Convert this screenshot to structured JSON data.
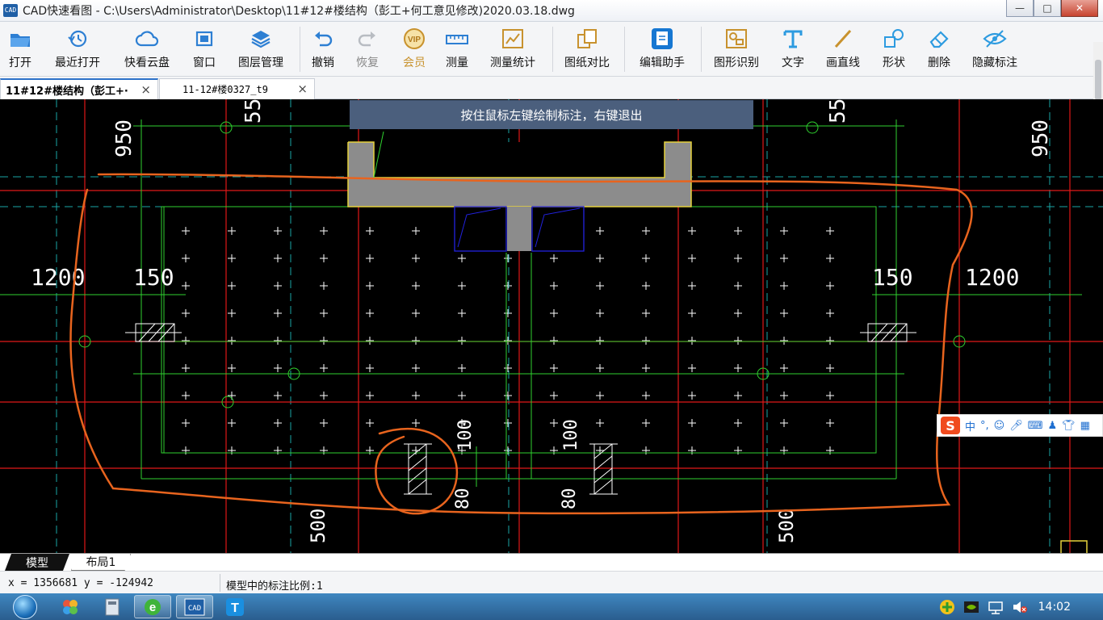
{
  "window": {
    "logo": "CAD",
    "title": "CAD快速看图 - C:\\Users\\Administrator\\Desktop\\11#12#楼结构（彭工+何工意见修改)2020.03.18.dwg",
    "controls": {
      "minimize": "—",
      "maximize": "□",
      "close": "✕"
    }
  },
  "toolbar": {
    "open": "打开",
    "recent": "最近打开",
    "cloud": "快看云盘",
    "window": "窗口",
    "layers": "图层管理",
    "undo": "撤销",
    "redo": "恢复",
    "vip": "会员",
    "vip_badge": "VIP",
    "measure": "测量",
    "measure_stats": "测量统计",
    "compare": "图纸对比",
    "edit_assistant": "编辑助手",
    "recognize": "图形识别",
    "text": "文字",
    "line": "画直线",
    "shape": "形状",
    "delete": "删除",
    "hide_marks": "隐藏标注",
    "more": "»"
  },
  "tabs": [
    {
      "label": "11#12#楼结构（彭工+·",
      "close": "×",
      "active": true
    },
    {
      "label": "11-12#楼0327_t9",
      "close": "×",
      "active": false
    }
  ],
  "canvas": {
    "hint": "按住鼠标左键绘制标注，右键退出",
    "dims": {
      "d55_left": "55",
      "d55_right": "55",
      "d950_left": "950",
      "d950_right": "950",
      "d1200_left": "1200",
      "d1200_right": "1200",
      "d150_left": "150",
      "d150_right": "150",
      "d100_left": "100",
      "d100_right": "100",
      "d80_left": "80",
      "d80_right": "80",
      "d500_left": "500",
      "d500_right": "500"
    }
  },
  "ime": {
    "logo": "S",
    "mode": "中",
    "punct": "°,"
  },
  "layout_tabs": {
    "model": "模型",
    "layout1": "布局1"
  },
  "status": {
    "coords": "x = 1356681  y = -124942",
    "scale": "模型中的标注比例:1"
  },
  "taskbar": {
    "clock": "14:02"
  },
  "colors": {
    "accent": "#2d72c8",
    "annotation": "#e8641e",
    "grid_red": "#e01818",
    "grid_green": "#2fd12f",
    "dim_white": "#ffffff",
    "wall_yellow": "#e6d23c",
    "concrete_gray": "#8c8c8c"
  }
}
